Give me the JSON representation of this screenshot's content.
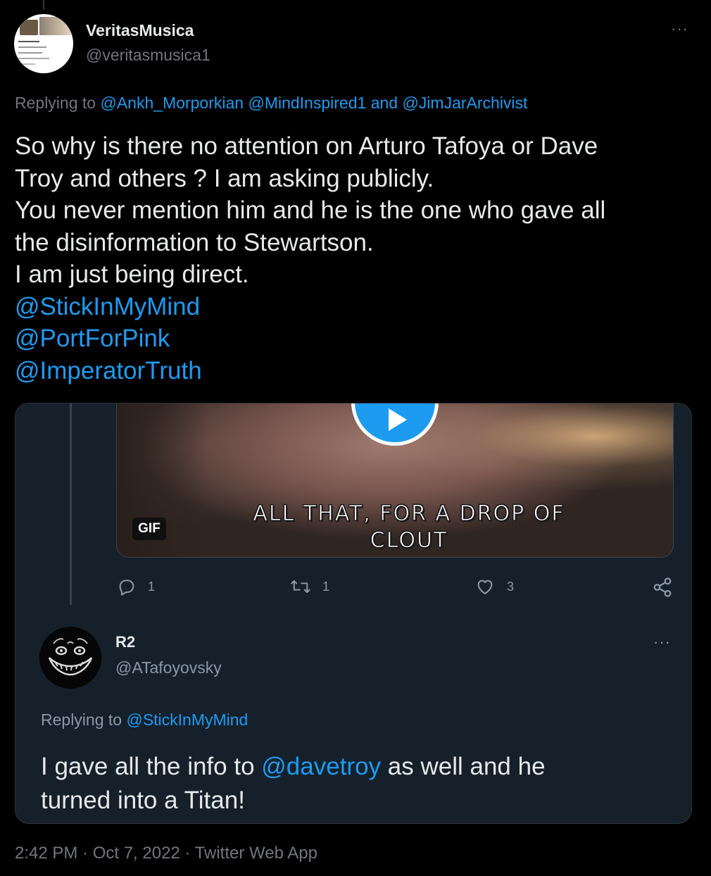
{
  "tweet": {
    "author_name": "VeritasMusica",
    "author_handle": "@veritasmusica1",
    "more_label": "···",
    "replying_prefix": "Replying to",
    "replying_mention_1": "@Ankh_Morporkian",
    "replying_mention_2": "@MindInspired1",
    "replying_and": "and",
    "replying_mention_3": "@JimJarArchivist",
    "body_lines": [
      "So why is there no attention on Arturo Tafoya or Dave",
      "Troy and others ? I am asking publicly.",
      "You never mention him and he is the one who gave all",
      "the disinformation to Stewartson.",
      "I am just being direct."
    ],
    "mentions": [
      "@StickInMyMind",
      "@PortForPink",
      "@ImperatorTruth"
    ],
    "timestamp": "2:42 PM · Oct 7, 2022 · Twitter Web App"
  },
  "quoted": {
    "gif": {
      "caption_line_1": "ALL THAT, FOR A DROP OF",
      "caption_line_2": "CLOUT",
      "badge": "GIF"
    },
    "actions": {
      "reply_count": "1",
      "retweet_count": "1",
      "like_count": "3"
    },
    "reply": {
      "author_name": "R2",
      "author_handle": "@ATafoyovsky",
      "more_label": "···",
      "replying_prefix": "Replying to",
      "replying_mention": "@StickInMyMind",
      "text_part_1": "I gave all the info to",
      "text_mention": "@davetroy",
      "text_part_2": "as well and he",
      "text_line_2": "turned into a Titan!"
    }
  },
  "colors": {
    "background": "#000000",
    "card_background": "#15202b",
    "link_blue": "#1d9bf0",
    "text_primary": "#e7e9ea",
    "text_secondary": "#71767b"
  }
}
